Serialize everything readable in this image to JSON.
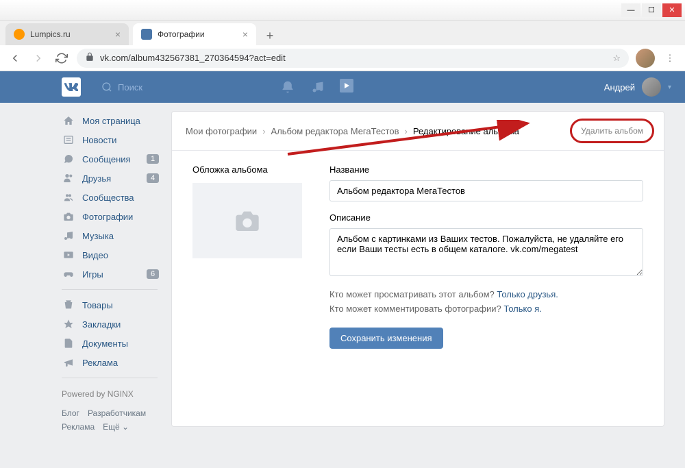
{
  "window": {
    "tabs": [
      {
        "title": "Lumpics.ru",
        "active": false
      },
      {
        "title": "Фотографии",
        "active": true
      }
    ],
    "url": "vk.com/album432567381_270364594?act=edit"
  },
  "header": {
    "search_placeholder": "Поиск",
    "username": "Андрей"
  },
  "sidebar": {
    "items": [
      {
        "icon": "home",
        "label": "Моя страница",
        "badge": ""
      },
      {
        "icon": "news",
        "label": "Новости",
        "badge": ""
      },
      {
        "icon": "message",
        "label": "Сообщения",
        "badge": "1"
      },
      {
        "icon": "friends",
        "label": "Друзья",
        "badge": "4"
      },
      {
        "icon": "group",
        "label": "Сообщества",
        "badge": ""
      },
      {
        "icon": "photo",
        "label": "Фотографии",
        "badge": ""
      },
      {
        "icon": "music",
        "label": "Музыка",
        "badge": ""
      },
      {
        "icon": "video",
        "label": "Видео",
        "badge": ""
      },
      {
        "icon": "game",
        "label": "Игры",
        "badge": "6"
      }
    ],
    "extra": [
      {
        "icon": "cart",
        "label": "Товары"
      },
      {
        "icon": "star",
        "label": "Закладки"
      },
      {
        "icon": "doc",
        "label": "Документы"
      },
      {
        "icon": "ad",
        "label": "Реклама"
      }
    ],
    "footer": "Powered by NGINX",
    "links": [
      "Блог",
      "Разработчикам",
      "Реклама",
      "Ещё ⌄"
    ]
  },
  "breadcrumb": {
    "items": [
      "Мои фотографии",
      "Альбом редактора МегаТестов",
      "Редактирование альбома"
    ],
    "delete": "Удалить альбом"
  },
  "form": {
    "cover_label": "Обложка альбома",
    "title_label": "Название",
    "title_value": "Альбом редактора МегаТестов",
    "desc_label": "Описание",
    "desc_value": "Альбом с картинками из Ваших тестов. Пожалуйста, не удаляйте его если Ваши тесты есть в общем каталоге. vk.com/megatest",
    "perm_view_q": "Кто может просматривать этот альбом? ",
    "perm_view_a": "Только друзья.",
    "perm_comment_q": "Кто может комментировать фотографии? ",
    "perm_comment_a": "Только я.",
    "save": "Сохранить изменения"
  }
}
